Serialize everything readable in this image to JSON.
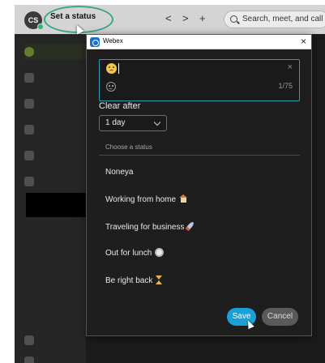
{
  "app": {
    "avatar_initials": "CS",
    "set_status_label": "Set a status",
    "nav_back": "<",
    "nav_forward": ">",
    "nav_add": "+",
    "search_placeholder": "Search, meet, and call"
  },
  "dialog": {
    "title": "Webex",
    "close_glyph": "×",
    "input_clear_glyph": "×",
    "char_count": "1/75",
    "clear_after_label": "Clear after",
    "clear_after_value": "1 day",
    "choose_status_label": "Choose a status",
    "statuses": [
      {
        "label": "Noneya",
        "icon": ""
      },
      {
        "label": "Working from home",
        "icon": "house-icon"
      },
      {
        "label": "Traveling for business",
        "icon": "rocket-icon"
      },
      {
        "label": "Out for lunch",
        "icon": "plate-icon"
      },
      {
        "label": "Be right back",
        "icon": "hourglass-icon"
      }
    ],
    "save_label": "Save",
    "cancel_label": "Cancel"
  },
  "colors": {
    "accent": "#1aa0d6",
    "input_focus_border": "#2a9cb6",
    "highlight_ring": "#3aa58c",
    "presence_available": "#2bb673"
  }
}
